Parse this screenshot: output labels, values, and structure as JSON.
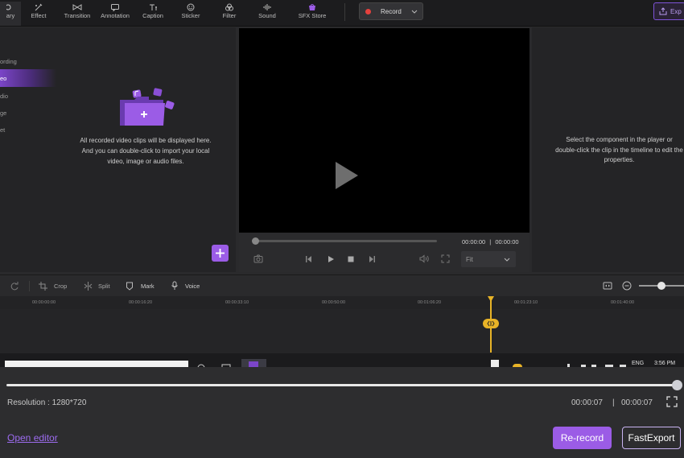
{
  "toolbar": {
    "tabs": [
      {
        "label": "ary",
        "icon": "library-icon"
      },
      {
        "label": "Effect",
        "icon": "effect-icon"
      },
      {
        "label": "Transition",
        "icon": "transition-icon"
      },
      {
        "label": "Annotation",
        "icon": "annotation-icon"
      },
      {
        "label": "Caption",
        "icon": "caption-icon"
      },
      {
        "label": "Sticker",
        "icon": "sticker-icon"
      },
      {
        "label": "Filter",
        "icon": "filter-icon"
      },
      {
        "label": "Sound",
        "icon": "sound-icon"
      },
      {
        "label": "SFX Store",
        "icon": "store-icon"
      }
    ],
    "record_label": "Record",
    "export_label": "Exp"
  },
  "sidebar": {
    "items": [
      {
        "label": "ording"
      },
      {
        "label": "eo"
      },
      {
        "label": "dio"
      },
      {
        "label": "ge"
      },
      {
        "label": "et"
      }
    ],
    "active_index": 1
  },
  "library": {
    "empty_text": "All recorded video clips will be displayed here. And you can double-click to import your local video, image or audio files."
  },
  "player": {
    "current_time": "00:00:00",
    "separator": "|",
    "total_time": "00:00:00",
    "fit_value": "Fit"
  },
  "properties": {
    "empty_text": "Select the component in the player or double-click the clip in the timeline to edit the properties."
  },
  "timeline": {
    "tools": [
      "Crop",
      "Split",
      "Mark",
      "Voice"
    ],
    "ruler_ticks": [
      "00:00:00:00",
      "00:00:16:20",
      "00:00:33:10",
      "00:00:50:00",
      "00:01:06:20",
      "00:01:23:10",
      "00:01:40:00"
    ]
  },
  "taskbar": {
    "language": "ENG",
    "clock": "3:56 PM"
  },
  "bottom": {
    "resolution": "Resolution : 1280*720",
    "elapsed": "00:00:07",
    "separator": "|",
    "duration": "00:00:07",
    "progress": 1.0,
    "open_editor": "Open editor",
    "rerecord_label": "Re-record",
    "fastexport_label": "FastExport"
  },
  "colors": {
    "accent": "#9b5ce6",
    "playhead": "#e8b327",
    "record_dot": "#e5413d"
  }
}
